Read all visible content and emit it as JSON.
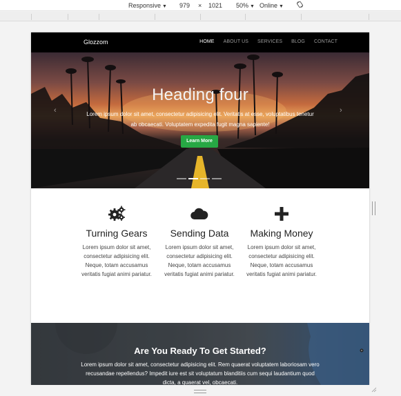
{
  "devtools": {
    "device": "Responsive",
    "width": "979",
    "times": "×",
    "height": "1021",
    "zoom": "50%",
    "network": "Online",
    "caret": "▼",
    "rotate_icon": "rotate-icon"
  },
  "site": {
    "brand": "Glozzom",
    "nav": [
      "HOME",
      "ABOUT US",
      "SERVICES",
      "BLOG",
      "CONTACT"
    ],
    "active_nav": "HOME"
  },
  "hero": {
    "heading": "Heading four",
    "text": "Lorem ipsum dolor sit amet, consectetur adipisicing elit. Veritatis at esse, voluptatibus tenetur ab obcaecati. Voluptatem expedita fugit magna sapiente!",
    "button": "Learn More",
    "prev": "‹",
    "next": "›",
    "slides_count": 4,
    "active_slide": 1
  },
  "features": [
    {
      "icon": "gears-icon",
      "title": "Turning Gears",
      "text": "Lorem ipsum dolor sit amet, consectetur adipisicing elit. Neque, totam accusamus veritatis fugiat animi pariatur."
    },
    {
      "icon": "cloud-icon",
      "title": "Sending Data",
      "text": "Lorem ipsum dolor sit amet, consectetur adipisicing elit. Neque, totam accusamus veritatis fugiat animi pariatur."
    },
    {
      "icon": "plus-icon",
      "title": "Making Money",
      "text": "Lorem ipsum dolor sit amet, consectetur adipisicing elit. Neque, totam accusamus veritatis fugiat animi pariatur."
    }
  ],
  "cta": {
    "title": "Are You Ready To Get Started?",
    "text": "Lorem ipsum dolor sit amet, consectetur adipisicing elit. Rem quaerat voluptatem laboriosam vero recusandae repellendus? Impedit iure est sit voluptatum blanditiis cum sequi laudantium quod dicta, a quaerat vel, obcaecati."
  },
  "colors": {
    "navbar": "#000000",
    "button_green": "#27a844",
    "cta_bg": "#464c52"
  }
}
